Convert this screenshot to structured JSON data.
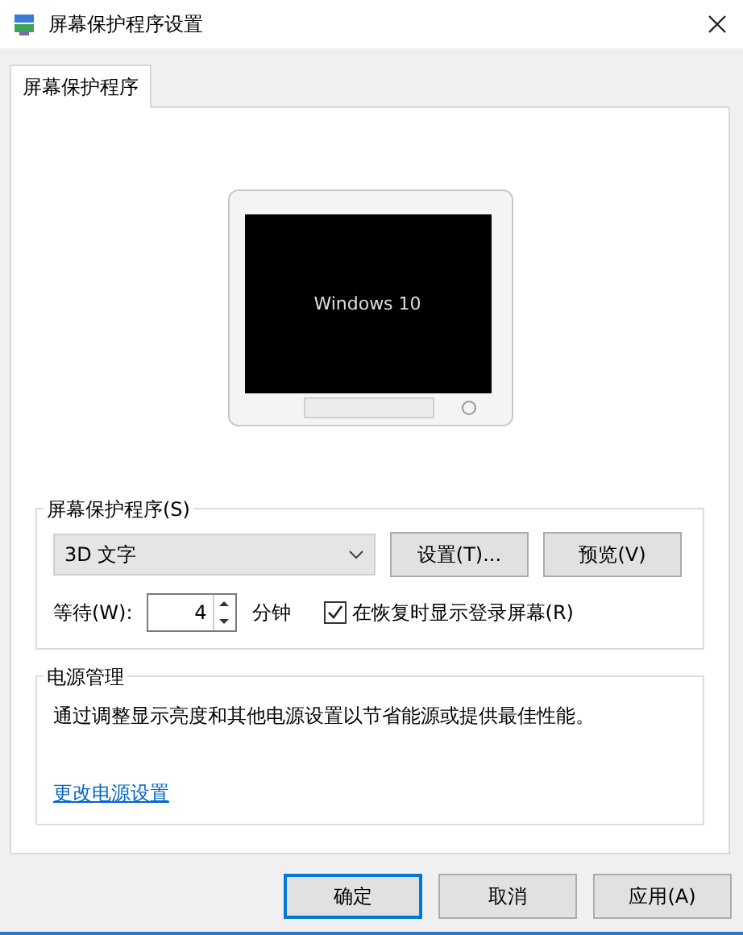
{
  "window": {
    "title": "屏幕保护程序设置"
  },
  "tabs": [
    {
      "label": "屏幕保护程序",
      "selected": true
    }
  ],
  "preview": {
    "text": "Windows 10"
  },
  "screensaver": {
    "legend": "屏幕保护程序(S)",
    "dropdown": "3D 文字",
    "settings_button": "设置(T)...",
    "preview_button": "预览(V)",
    "wait_label": "等待(W):",
    "wait_value": "4",
    "wait_unit": "分钟",
    "resume_checkbox": {
      "label": "在恢复时显示登录屏幕(R)",
      "checked": true
    }
  },
  "power": {
    "legend": "电源管理",
    "description": "通过调整显示亮度和其他电源设置以节省能源或提供最佳性能。",
    "link": "更改电源设置"
  },
  "buttons": [
    {
      "label": "确定",
      "default": true
    },
    {
      "label": "取消",
      "default": false
    },
    {
      "label": "应用(A)",
      "default": false
    }
  ]
}
